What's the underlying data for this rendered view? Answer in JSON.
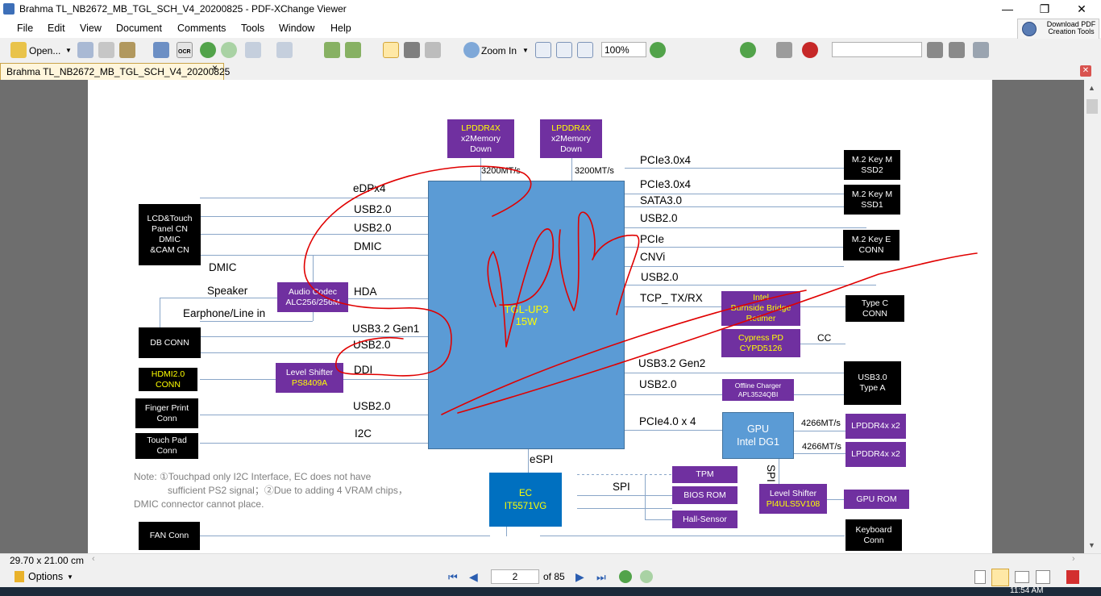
{
  "window": {
    "title": "Brahma TL_NB2672_MB_TGL_SCH_V4_20200825 - PDF-XChange Viewer",
    "controls": [
      "—",
      "❐",
      "✕"
    ]
  },
  "menu": [
    "File",
    "Edit",
    "View",
    "Document",
    "Comments",
    "Tools",
    "Window",
    "Help"
  ],
  "download_button": {
    "line1": "Download PDF",
    "line2": "Creation Tools"
  },
  "toolbar": {
    "open_label": "Open...",
    "ocr_label": "OCR",
    "zoom_in_label": "Zoom In",
    "zoom_value": "100%",
    "search_value": "",
    "zoom_slider_fraction": 0.5
  },
  "tab": {
    "label": "Brahma TL_NB2672_MB_TGL_SCH_V4_20200825",
    "close": "×"
  },
  "schematic": {
    "cpu": {
      "line1": "TGL-UP3",
      "line2": "15W"
    },
    "mem1": {
      "l1": "LPDDR4X",
      "l2": "x2Memory",
      "l3": "Down",
      "speed": "3200MT/s"
    },
    "mem2": {
      "l1": "LPDDR4X",
      "l2": "x2Memory",
      "l3": "Down",
      "speed": "3200MT/s"
    },
    "left_blocks": {
      "lcd": [
        "LCD&Touch",
        "Panel CN",
        "DMIC",
        "&CAM CN"
      ],
      "db_conn": "DB CONN",
      "hdmi": [
        "HDMI2.0",
        "CONN"
      ],
      "finger": [
        "Finger Print",
        "Conn"
      ],
      "touchpad": [
        "Touch Pad",
        "Conn"
      ],
      "fan": "FAN Conn",
      "audio": [
        "Audio Codec",
        "ALC256/256M"
      ],
      "level_shifter": [
        "Level Shifter",
        "PS8409A"
      ]
    },
    "left_signals": {
      "edp": "eDPx4",
      "usb_a": "USB2.0",
      "usb_b": "USB2.0",
      "dmic": "DMIC",
      "dmic2": "DMIC",
      "speaker": "Speaker",
      "hda": "HDA",
      "earphone": "Earphone/Line in",
      "usb32": "USB3.2 Gen1",
      "usb_c": "USB2.0",
      "ddi": "DDI",
      "usb_d": "USB2.0",
      "i2c": "I2C"
    },
    "right_signals": {
      "pcie1": "PCIe3.0x4",
      "pcie2": "PCIe3.0x4",
      "sata": "SATA3.0",
      "usb_e": "USB2.0",
      "pcie3": "PCIe",
      "cnvi": "CNVi",
      "usb_f": "USB2.0",
      "tcp": "TCP_ TX/RX",
      "cc": "CC",
      "usb32g2": "USB3.2 Gen2",
      "usb_g": "USB2.0",
      "pcie4": "PCIe4.0 x 4",
      "espi": "eSPI",
      "spi": "SPI",
      "spi2": "SPI",
      "gpu_speed1": "4266MT/s",
      "gpu_speed2": "4266MT/s"
    },
    "right_blocks": {
      "ssd2": [
        "M.2 Key M",
        "SSD2"
      ],
      "ssd1": [
        "M.2 Key M",
        "SSD1"
      ],
      "keye": [
        "M.2 Key E",
        "CONN"
      ],
      "typec": [
        "Type C",
        "CONN"
      ],
      "usb30": [
        "USB3.0",
        "Type A"
      ],
      "retimer": [
        "Intel",
        "Burnside Bridge",
        "Retimer"
      ],
      "cypress": [
        "Cypress PD",
        "CYPD5126"
      ],
      "charger": [
        "Offline Charger",
        "APL3524QBI"
      ],
      "gpu": [
        "GPU",
        "Intel DG1"
      ],
      "lpddr_a": "LPDDR4x x2",
      "lpddr_b": "LPDDR4x x2",
      "tpm": "TPM",
      "bios": "BIOS ROM",
      "hall": "Hall-Sensor",
      "ls2": [
        "Level Shifter",
        "PI4ULS5V108"
      ],
      "gpurom": "GPU ROM",
      "keyboard": [
        "Keyboard",
        "Conn"
      ],
      "ec": [
        "EC",
        "IT5571VG"
      ]
    },
    "note": {
      "line1": "Note: ①Touchpad only I2C Interface, EC does not have",
      "line2": "sufficient PS2 signal；②Due to adding 4 VRAM chips，",
      "line3": "DMIC connector  cannot place."
    }
  },
  "status": {
    "page_size": "29.70 x 21.00 cm"
  },
  "navigation": {
    "options_label": "Options",
    "current_page": "2",
    "total": "of 85"
  },
  "taskbar": {
    "clock": "11:54 AM"
  },
  "colors": {
    "accent_purple": "#7030a0",
    "cpu_blue": "#5b9bd5",
    "ec_blue": "#0070c0",
    "annotation_red": "#e00000"
  }
}
